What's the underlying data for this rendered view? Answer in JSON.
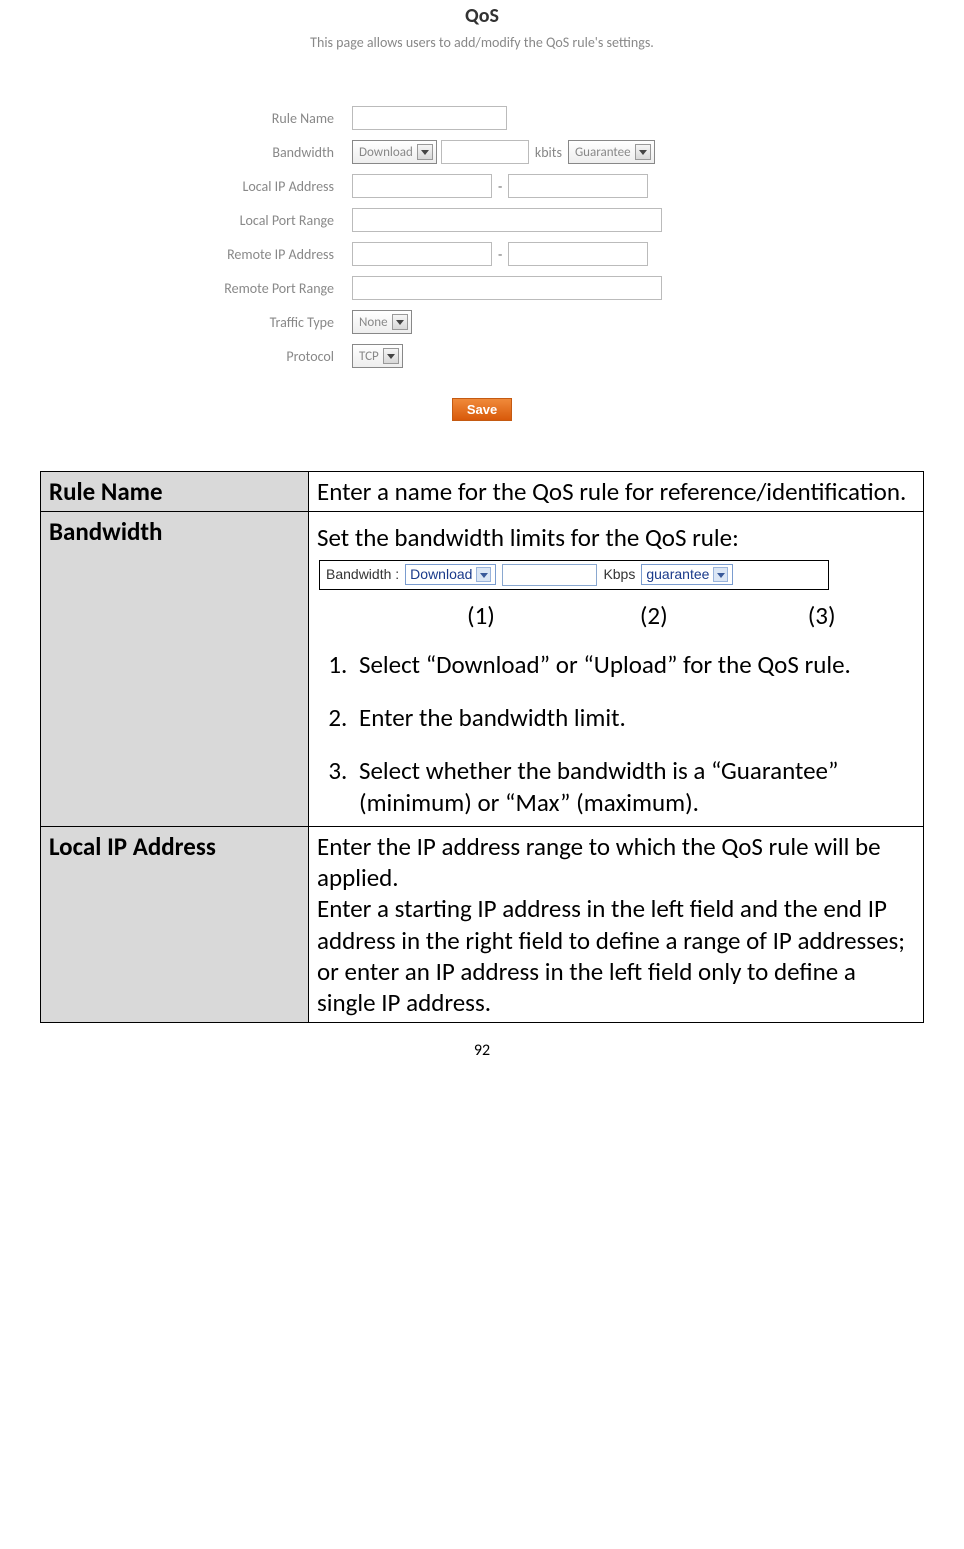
{
  "qos": {
    "title": "QoS",
    "desc": "This page allows users to add/modify the QoS rule's settings.",
    "labels": {
      "rule_name": "Rule Name",
      "bandwidth": "Bandwidth",
      "local_ip": "Local IP Address",
      "local_port": "Local Port Range",
      "remote_ip": "Remote IP Address",
      "remote_port": "Remote Port Range",
      "traffic_type": "Traffic Type",
      "protocol": "Protocol"
    },
    "selects": {
      "bandwidth_dir": "Download",
      "bandwidth_units": "kbits",
      "bandwidth_mode": "Guarantee",
      "traffic_type": "None",
      "protocol": "TCP"
    },
    "save": "Save"
  },
  "doc": {
    "rows": {
      "rule_name": {
        "head": "Rule Name",
        "body": "Enter a name for the QoS rule for reference/identification."
      },
      "bandwidth": {
        "head": "Bandwidth",
        "intro": "Set the bandwidth limits for the QoS rule:",
        "fig": {
          "label": "Bandwidth :",
          "dir": "Download",
          "units": "Kbps",
          "mode": "guarantee"
        },
        "nums": {
          "n1": "(1)",
          "n2": "(2)",
          "n3": "(3)"
        },
        "steps": [
          "Select “Download” or “Upload” for the QoS rule.",
          "Enter the bandwidth limit.",
          "Select whether the bandwidth is a “Guarantee” (minimum) or “Max” (maximum)."
        ]
      },
      "local_ip": {
        "head": "Local IP Address",
        "body": "Enter the IP address range to which the QoS rule will be applied.\nEnter a starting IP address in the left field and the end IP address in the right field to define a range of IP addresses; or enter an IP address in the left field only to define a single IP address."
      }
    }
  },
  "page_number": "92"
}
